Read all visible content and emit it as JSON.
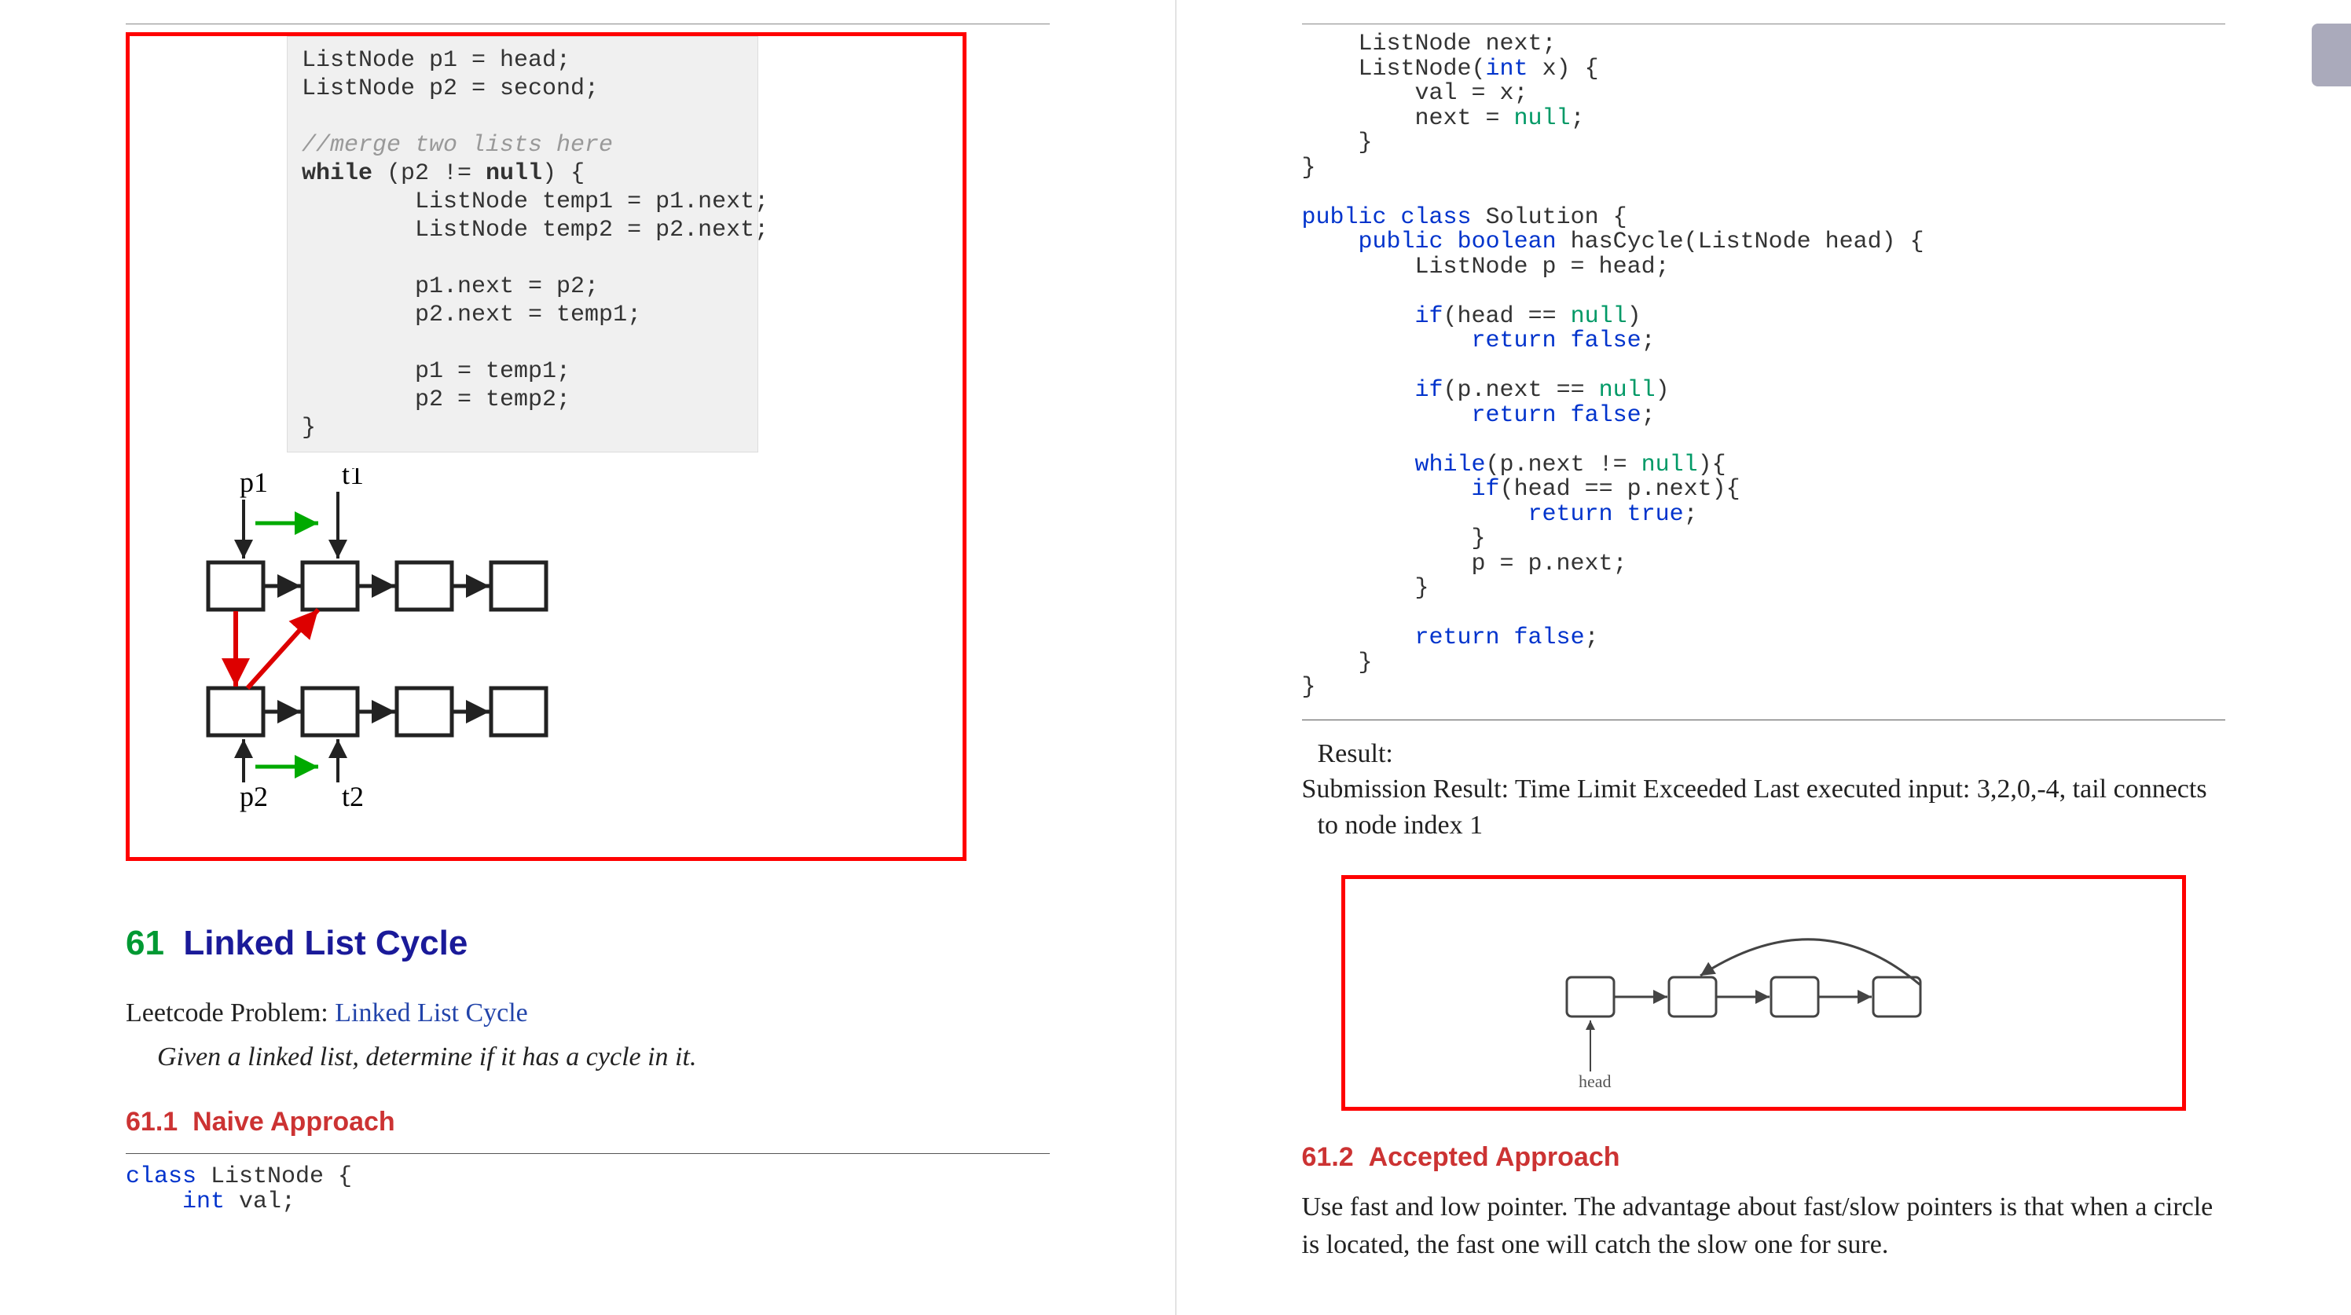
{
  "left": {
    "code_merge": "ListNode p1 = head;\nListNode p2 = second;\n\n//merge two lists here\nwhile (p2 != null) {\n        ListNode temp1 = p1.next;\n        ListNode temp2 = p2.next;\n\n        p1.next = p2;\n        p2.next = temp1;\n\n        p1 = temp1;\n        p2 = temp2;\n}",
    "sketch_labels": {
      "p1": "p1",
      "t1": "t1",
      "p2": "p2",
      "t2": "t2"
    },
    "section_number": "61",
    "section_title": "Linked List Cycle",
    "leetcode_label": "Leetcode Problem: ",
    "leetcode_link": "Linked List Cycle",
    "problem_statement": "Given a linked list, determine if it has a cycle in it.",
    "sub1_number": "61.1",
    "sub1_title": "Naive Approach",
    "code_naive_start": "class ListNode {\n    int val;"
  },
  "right": {
    "code_solution": "    ListNode next;\n    ListNode(int x) {\n        val = x;\n        next = null;\n    }\n}\n\npublic class Solution {\n    public boolean hasCycle(ListNode head) {\n        ListNode p = head;\n\n        if(head == null)\n            return false;\n\n        if(p.next == null)\n            return false;\n\n        while(p.next != null){\n            if(head == p.next){\n                return true;\n            }\n            p = p.next;\n        }\n\n        return false;\n    }\n}",
    "result_label": "Result:",
    "result_text": "Submission Result: Time Limit Exceeded Last executed input: 3,2,0,-4, tail connects to node index 1",
    "diagram_head_label": "head",
    "sub2_number": "61.2",
    "sub2_title": "Accepted Approach",
    "accepted_text": "Use fast and low pointer. The advantage about fast/slow pointers is that when a circle is located, the fast one will catch the slow one for sure."
  }
}
